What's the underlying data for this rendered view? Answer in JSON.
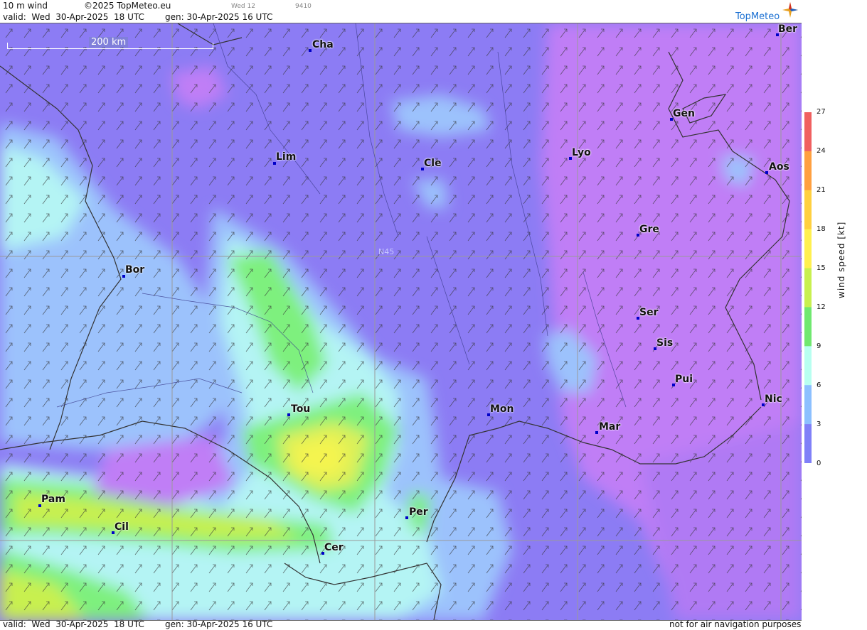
{
  "header": {
    "product": "10 m wind",
    "copyright": "©2025 TopMeteo.eu",
    "valid": "valid:  Wed  30-Apr-2025  18 UTC",
    "gen": "gen: 30-Apr-2025 16 UTC",
    "day_code": "Wed 12",
    "run_code": "9410"
  },
  "logo": {
    "text": "TopMeteo",
    "icon": "compass-star-icon"
  },
  "map": {
    "scale_label": "200 km",
    "lat_label": "N45",
    "cities": [
      {
        "name": "Cha"
      },
      {
        "name": "Ber"
      },
      {
        "name": "Gen"
      },
      {
        "name": "Lim"
      },
      {
        "name": "Cle"
      },
      {
        "name": "Lyo"
      },
      {
        "name": "Aos"
      },
      {
        "name": "Gre"
      },
      {
        "name": "Bor"
      },
      {
        "name": "Ser"
      },
      {
        "name": "Sis"
      },
      {
        "name": "Pui"
      },
      {
        "name": "Tou"
      },
      {
        "name": "Mon"
      },
      {
        "name": "Nic"
      },
      {
        "name": "Mar"
      },
      {
        "name": "Pam"
      },
      {
        "name": "Per"
      },
      {
        "name": "Cil"
      },
      {
        "name": "Cer"
      }
    ]
  },
  "legend": {
    "title": "wind speed [kt]",
    "ticks": [
      "27",
      "24",
      "21",
      "18",
      "15",
      "12",
      "9",
      "6",
      "3",
      "0"
    ],
    "colors": [
      "#f06060",
      "#ffa040",
      "#ffd040",
      "#fff050",
      "#c8f050",
      "#70e870",
      "#b8fff0",
      "#8cc0ff",
      "#8080f8",
      "#c080f8"
    ]
  },
  "footer": {
    "valid": "valid:  Wed  30-Apr-2025  18 UTC",
    "gen": "gen: 30-Apr-2025 16 UTC",
    "disclaimer": "not for air navigation purposes"
  }
}
